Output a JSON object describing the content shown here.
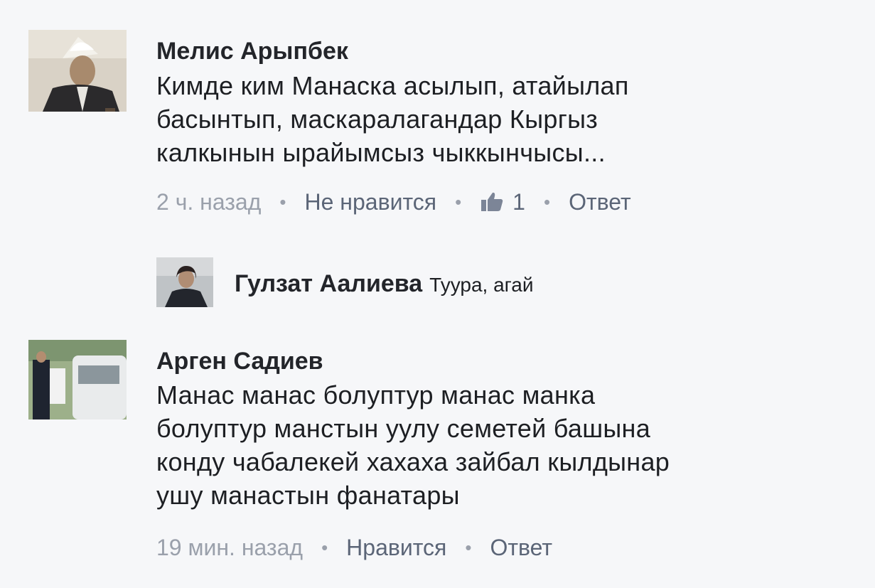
{
  "comments": [
    {
      "author": "Мелис Арыпбек",
      "text_lines": [
        "Кимде ким Манаска асылып, атайылап",
        "басынтып, маскаралагандар Кыргыз",
        "калкынын ырайымсыз чыккынчысы..."
      ],
      "time": "2 ч. назад",
      "like_action": "Не нравится",
      "like_count": "1",
      "reply_action": "Ответ",
      "separator": "•"
    },
    {
      "author": "Арген Садиев",
      "text_lines": [
        "Манас манас болуптур манас манка",
        "болуптур манстын уулу семетей башына",
        "конду чабалекей хахаха зайбал кылдынар",
        "ушу манастын фанатары"
      ],
      "time": "19 мин. назад",
      "like_action": "Нравится",
      "reply_action": "Ответ",
      "separator": "•"
    }
  ],
  "reply": {
    "author": "Гулзат Аалиева",
    "text": "Туура, агай"
  },
  "icons": {
    "like": "thumbs-up-icon"
  },
  "colors": {
    "background": "#f6f7f9",
    "author": "#23252a",
    "meta_gray": "#9aa0ab",
    "action": "#5b6577"
  }
}
